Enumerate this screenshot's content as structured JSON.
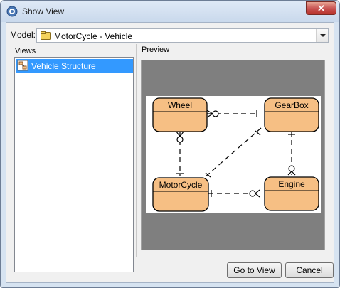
{
  "window": {
    "title": "Show View"
  },
  "model": {
    "label": "Model:",
    "value": "MotorCycle - Vehicle"
  },
  "views": {
    "label": "Views",
    "items": [
      {
        "label": "Vehicle Structure",
        "selected": true
      }
    ]
  },
  "preview": {
    "label": "Preview",
    "entities": {
      "wheel": "Wheel",
      "gearbox": "GearBox",
      "motorcycle": "MotorCycle",
      "engine": "Engine"
    }
  },
  "buttons": {
    "goto": "Go to View",
    "cancel": "Cancel"
  },
  "colors": {
    "entity_fill": "#f6bf84",
    "selection": "#3399ff",
    "preview_bg": "#7f7f7f",
    "close_button": "#c75050"
  }
}
